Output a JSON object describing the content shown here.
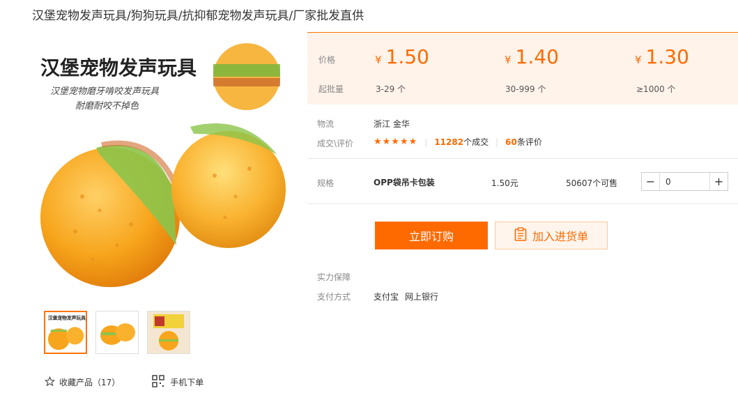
{
  "product": {
    "title": "汉堡宠物发声玩具/狗狗玩具/抗抑郁宠物发声玩具/厂家批发直供",
    "image_text": {
      "headline": "汉堡宠物发声玩具",
      "line1": "汉堡宠物磨牙啃咬发声玩具",
      "line2": "耐磨耐咬不掉色"
    }
  },
  "thumbnails": [
    {
      "name": "thumb-1",
      "headline": "汉堡宠物发声玩具",
      "active": true
    },
    {
      "name": "thumb-2",
      "active": false
    },
    {
      "name": "thumb-3",
      "active": false
    }
  ],
  "bottom_actions": {
    "favorite_label": "收藏产品（17）",
    "mobile_order_label": "手机下单"
  },
  "price_panel": {
    "price_label": "价格",
    "moq_label": "起批量",
    "currency": "¥",
    "tiers": [
      {
        "price": "1.50",
        "range": "3-29 个"
      },
      {
        "price": "1.40",
        "range": "30-999 个"
      },
      {
        "price": "1.30",
        "range": "≥1000 个"
      }
    ]
  },
  "logistics": {
    "label": "物流",
    "value": "浙江 金华",
    "deal_label": "成交\\评价",
    "stars": "★★★★★",
    "deals_count": "11282",
    "deals_suffix": "个成交",
    "reviews_count": "60",
    "reviews_suffix": "条评价",
    "star_count": 5
  },
  "spec": {
    "label": "规格",
    "name": "OPP袋吊卡包装",
    "price": "1.50元",
    "stock": "50607个可售",
    "quantity": "0",
    "minus": "−",
    "plus": "+"
  },
  "buttons": {
    "buy_now": "立即订购",
    "add_to_cart": "加入进货单"
  },
  "service": {
    "guarantee_label": "实力保障",
    "payment_label": "支付方式",
    "payment_methods": [
      "支付宝",
      "网上银行"
    ]
  },
  "colors": {
    "accent": "#ff6a00",
    "panel_bg": "#fff3ea"
  }
}
